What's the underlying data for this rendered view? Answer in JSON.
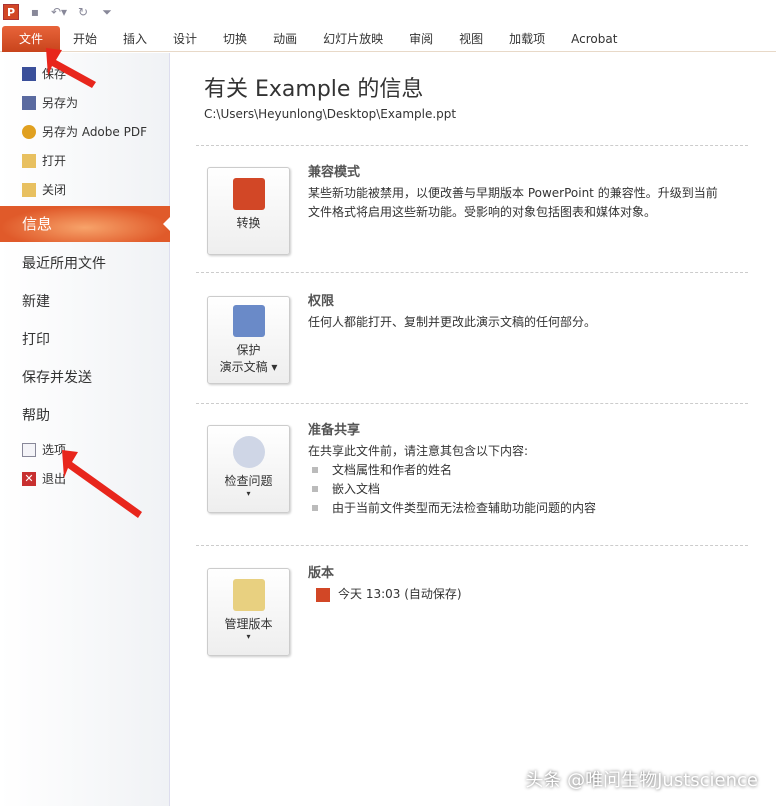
{
  "qat": {
    "app_icon": "P"
  },
  "tabs": [
    "文件",
    "开始",
    "插入",
    "设计",
    "切换",
    "动画",
    "幻灯片放映",
    "审阅",
    "视图",
    "加载项",
    "Acrobat"
  ],
  "left": {
    "small_top": [
      {
        "label": "保存",
        "icon": "save-icon"
      },
      {
        "label": "另存为",
        "icon": "save-as-icon"
      },
      {
        "label": "另存为 Adobe PDF",
        "icon": "pdf-icon"
      },
      {
        "label": "打开",
        "icon": "open-folder-icon"
      },
      {
        "label": "关闭",
        "icon": "close-folder-icon"
      }
    ],
    "selected": "信息",
    "big": [
      "最近所用文件",
      "新建",
      "打印",
      "保存并发送",
      "帮助"
    ],
    "small_bottom": [
      {
        "label": "选项",
        "icon": "options-icon"
      },
      {
        "label": "退出",
        "icon": "exit-icon"
      }
    ]
  },
  "main": {
    "title": "有关 Example 的信息",
    "path": "C:\\Users\\Heyunlong\\Desktop\\Example.ppt",
    "sections": [
      {
        "button": "转换",
        "title": "兼容模式",
        "text": "某些新功能被禁用，以便改善与早期版本 PowerPoint 的兼容性。升级到当前文件格式将启用这些新功能。受影响的对象包括图表和媒体对象。"
      },
      {
        "button": "保护\n演示文稿 ▾",
        "button_l1": "保护",
        "button_l2": "演示文稿 ▾",
        "title": "权限",
        "text": "任何人都能打开、复制并更改此演示文稿的任何部分。"
      },
      {
        "button_l1": "检查问题",
        "button_l2": "▾",
        "title": "准备共享",
        "text": "在共享此文件前，请注意其包含以下内容:",
        "bullets": [
          "文档属性和作者的姓名",
          "嵌入文档",
          "由于当前文件类型而无法检查辅助功能问题的内容"
        ]
      },
      {
        "button_l1": "管理版本",
        "button_l2": "▾",
        "title": "版本",
        "version": "今天 13:03 (自动保存)"
      }
    ]
  },
  "watermark": "头条 @唯问生物Justscience",
  "colors": {
    "accent": "#e05a2a",
    "arrow": "#e8261c"
  }
}
